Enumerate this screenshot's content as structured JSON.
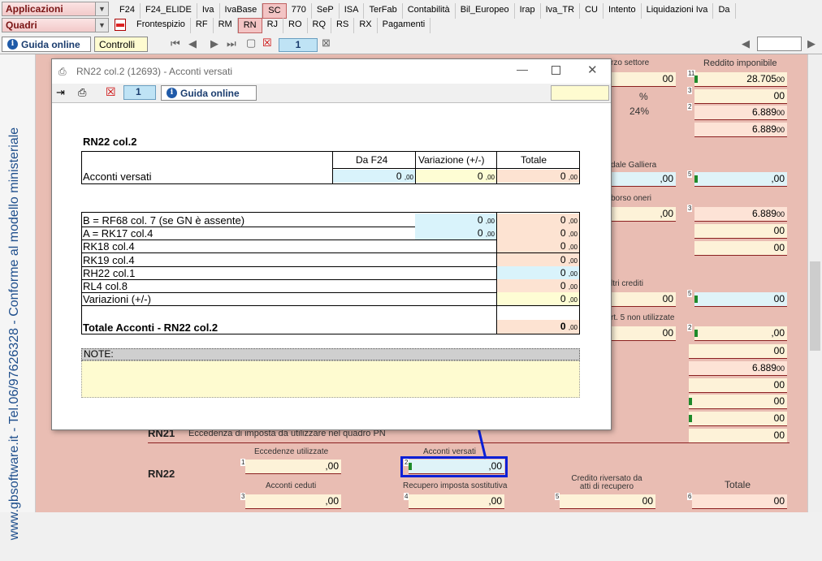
{
  "top": {
    "applicazioni_label": "Applicazioni",
    "quadri_label": "Quadri",
    "tabs_row1": [
      "F24",
      "F24_ELIDE",
      "Iva",
      "IvaBase",
      "SC",
      "770",
      "SeP",
      "ISA",
      "TerFab",
      "Contabilità",
      "Bil_Europeo",
      "Irap",
      "Iva_TR",
      "CU",
      "Intento",
      "Liquidazioni Iva",
      "Da"
    ],
    "active_tab1": "SC",
    "tabs_row2": [
      "Frontespizio",
      "RF",
      "RM",
      "RN",
      "RJ",
      "RO",
      "RQ",
      "RS",
      "RX",
      "Pagamenti"
    ],
    "active_tab2": "RN",
    "guida_label": "Guida online",
    "controlli_label": "Controlli",
    "page_number": "1"
  },
  "sidebar": {
    "vertical_text": "www.gbsoftware.it - Tel.06/97626328 - Conforme al modello ministeriale"
  },
  "background": {
    "labels": {
      "settore": "rzo settore",
      "reddito": "Reddito imponibile",
      "galliera": "dale Galliera",
      "rimborso": "borso oneri",
      "altri": "ltri crediti",
      "non_util": "rt. 5 non utilizzate",
      "rn21_code": "RN21",
      "rn21_desc": "Eccedenza di imposta da utilizzare nel quadro PN",
      "rn22_code": "RN22",
      "eccedenze": "Eccedenze utilizzate",
      "acconti_versati": "Acconti versati",
      "acconti_ceduti": "Acconti ceduti",
      "recupero": "Recupero imposta sostitutiva",
      "credito_riv": "Credito riversato da atti di recupero",
      "totale": "Totale"
    },
    "values": {
      "reddito": "28.705",
      "v2": "6.889",
      "v3": "6.889",
      "perc": "24%",
      "pct_sign": "%",
      "v_oneri": "6.889",
      "v_low": "6.889",
      "zero": "00",
      "zero_dec": ",00"
    }
  },
  "dialog": {
    "title": "RN22 col.2 (12693) - Acconti versati",
    "page": "1",
    "guida_label": "Guida online",
    "section_title": "RN22 col.2",
    "headers": {
      "daf24": "Da F24",
      "variazione": "Variazione (+/-)",
      "totale": "Totale"
    },
    "acconti_label": "Acconti versati",
    "acconti_daf24": "0",
    "acconti_var": "0",
    "acconti_tot": "0",
    "dec": ",00",
    "rows": [
      {
        "label": "B = RF68 col. 7 (se GN è assente)",
        "mid": "0",
        "tot": "0"
      },
      {
        "label": "A = RK17 col.4",
        "mid": "0",
        "tot": "0"
      },
      {
        "label": "RK18 col.4",
        "mid": "",
        "tot": "0"
      },
      {
        "label": "RK19 col.4",
        "mid": "",
        "tot": "0"
      },
      {
        "label": "RH22 col.1",
        "mid": "",
        "tot": "0"
      },
      {
        "label": "RL4 col.8",
        "mid": "",
        "tot": "0"
      },
      {
        "label": "Variazioni (+/-)",
        "mid": "",
        "tot": "0"
      }
    ],
    "totale_label": "Totale Acconti - RN22 col.2",
    "totale_value": "0",
    "note_label": "NOTE:"
  },
  "colors": {
    "accent_blue": "#0a1fd6",
    "form_bg": "#e9bdb3"
  }
}
